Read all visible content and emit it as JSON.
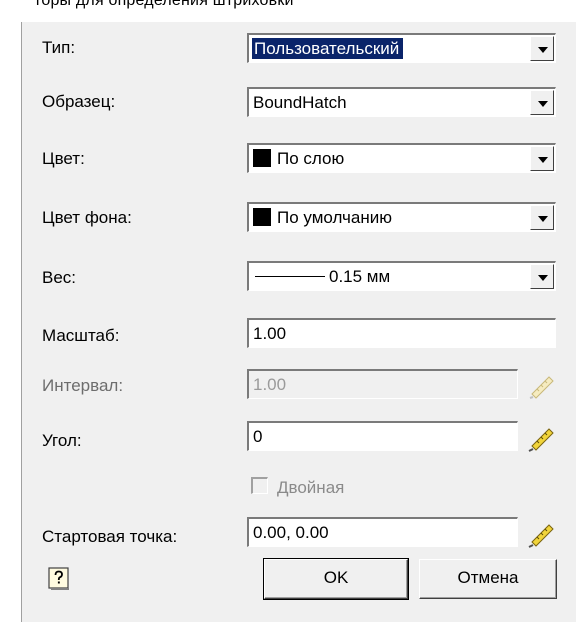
{
  "top_fragment": "торы для определения штриховки",
  "fields": {
    "type": {
      "label": "Тип:",
      "value": "Пользовательский"
    },
    "pattern": {
      "label": "Образец:",
      "value": "BoundHatch"
    },
    "color": {
      "label": "Цвет:",
      "value": "По слою"
    },
    "bg_color": {
      "label": "Цвет фона:",
      "value": "По умолчанию"
    },
    "weight": {
      "label": "Вес:",
      "value": "0.15 мм"
    },
    "scale": {
      "label": "Масштаб:",
      "value": "1.00"
    },
    "interval": {
      "label": "Интервал:",
      "value": "1.00"
    },
    "angle": {
      "label": "Угол:",
      "value": "0"
    },
    "double": {
      "label": "Двойная",
      "checked": false,
      "enabled": false
    },
    "start_point": {
      "label": "Стартовая точка:",
      "value": "0.00, 0.00"
    }
  },
  "buttons": {
    "ok": "OK",
    "cancel": "Отмена"
  },
  "icons": {
    "dropdown": "chevron-down-icon",
    "pick": "ruler-pencil-icon",
    "help": "help-icon"
  },
  "colors": {
    "selection": "#0a246a",
    "dialog_bg": "#f0f0f0",
    "swatch": "#000000"
  }
}
